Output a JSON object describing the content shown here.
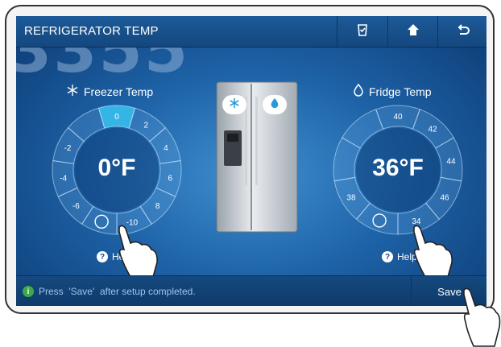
{
  "header": {
    "title": "REFRIGERATOR TEMP",
    "watermark": "3355",
    "buttons": [
      {
        "icon": "fridge-check-icon"
      },
      {
        "icon": "home-icon"
      },
      {
        "icon": "back-icon"
      }
    ]
  },
  "freezer": {
    "label": "Freezer Temp",
    "icon": "snowflake-icon",
    "value": "0°F",
    "selected": "0",
    "ticks": [
      "0",
      "2",
      "4",
      "6",
      "8",
      "-10",
      "-8",
      "-6",
      "-4",
      "-2"
    ],
    "help_label": "He"
  },
  "fridge": {
    "label": "Fridge Temp",
    "icon": "water-drop-icon",
    "value": "36°F",
    "selected": "36",
    "ticks": [
      "40",
      "42",
      "44",
      "46",
      "34",
      "36",
      "38"
    ],
    "help_label": "Help"
  },
  "status": {
    "message": "Press  'Save'  after setup completed.",
    "info_icon": "info-icon"
  },
  "save_button": {
    "label": "Save"
  },
  "colors": {
    "screen_dark": "#0c3a72",
    "screen_light": "#3f8fcf",
    "selected_segment": "#35b5e6",
    "topbar": "#1c5a98"
  }
}
